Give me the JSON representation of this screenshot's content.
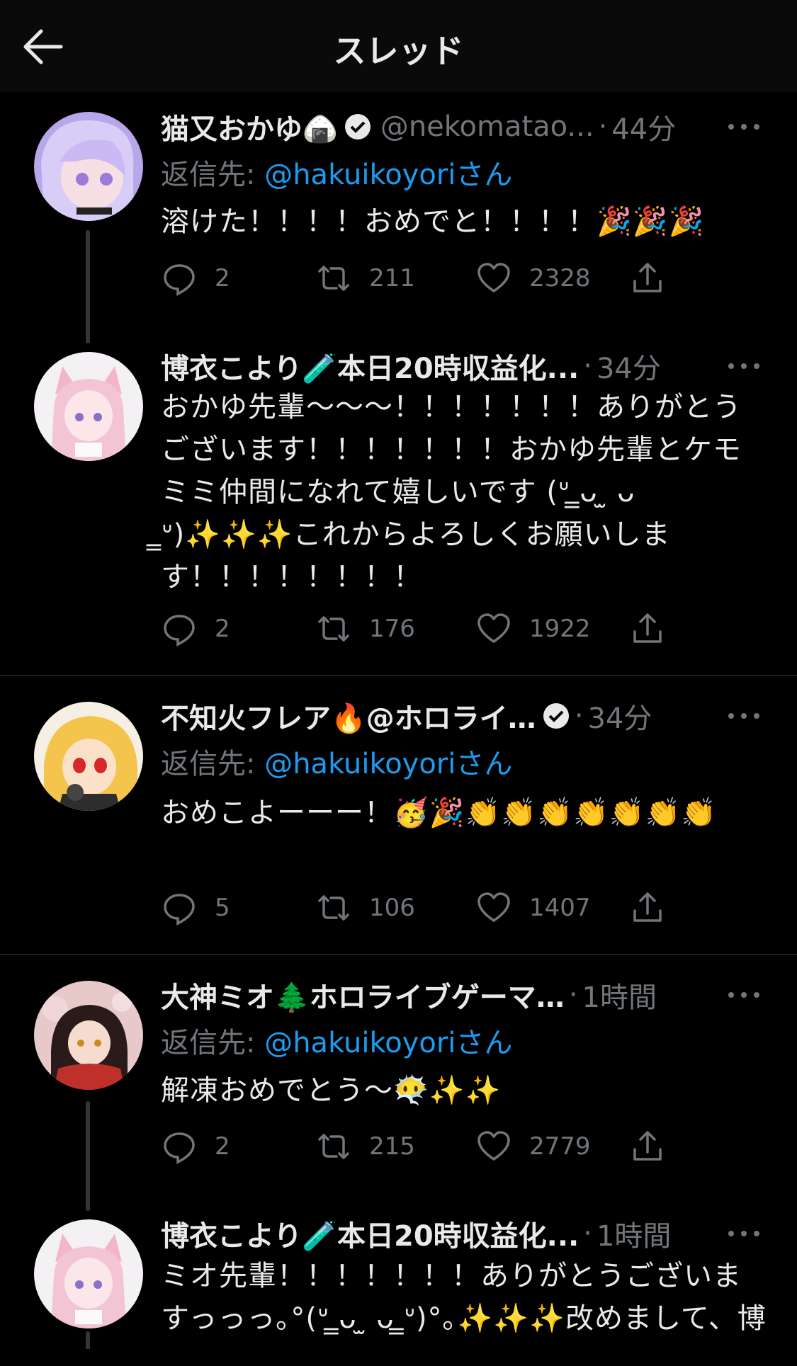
{
  "header": {
    "title": "スレッド"
  },
  "reply_prefix": "返信先: ",
  "reply_suffix": "さん",
  "tweets": [
    {
      "name": "猫又おかゆ🍙",
      "verified": true,
      "handle": "@nekomatao...",
      "time": "44分",
      "reply_to": "@hakuikoyori",
      "text": "溶けた！！！！おめでと！！！！🎉🎉🎉",
      "replies": "2",
      "retweets": "211",
      "likes": "2328"
    },
    {
      "name": "博衣こより🧪本日20時収益化...",
      "verified": false,
      "handle": "",
      "time": "34分",
      "reply_to": "",
      "text": "おかゆ先輩〜〜〜！！！！！！！ありがとうございます！！！！！！！おかゆ先輩とケモミミ仲間になれて嬉しいです (ᐡ ̳ᴗ ̫ ᴗ ̳ᐡ)✨✨✨これからよろしくお願いします！！！！！！！！",
      "replies": "2",
      "retweets": "176",
      "likes": "1922"
    },
    {
      "name": "不知火フレア🔥@ホロライ…",
      "verified": true,
      "handle": "",
      "time": "34分",
      "reply_to": "@hakuikoyori",
      "text": "おめこよーーー！🥳🎉👏👏👏👏👏👏👏",
      "replies": "5",
      "retweets": "106",
      "likes": "1407"
    },
    {
      "name": "大神ミオ🌲ホロライブゲーマ…",
      "verified": false,
      "handle": "",
      "time": "1時間",
      "reply_to": "@hakuikoyori",
      "text": "解凍おめでとう〜😶‍🌫️✨✨",
      "replies": "2",
      "retweets": "215",
      "likes": "2779"
    },
    {
      "name": "博衣こより🧪本日20時収益化...",
      "verified": false,
      "handle": "",
      "time": "1時間",
      "reply_to": "",
      "text": "ミオ先輩！！！！！！！ありがとうございますっっっ｡°(ᐡ ̳ᴗ ̫ ᴗ ̳ᐡ)°｡✨✨✨改めまして、博",
      "replies": "",
      "retweets": "",
      "likes": ""
    }
  ],
  "colors": {
    "background": "#000000",
    "text": "#e7e9ea",
    "muted": "#71767b",
    "link": "#1d9bf0"
  }
}
